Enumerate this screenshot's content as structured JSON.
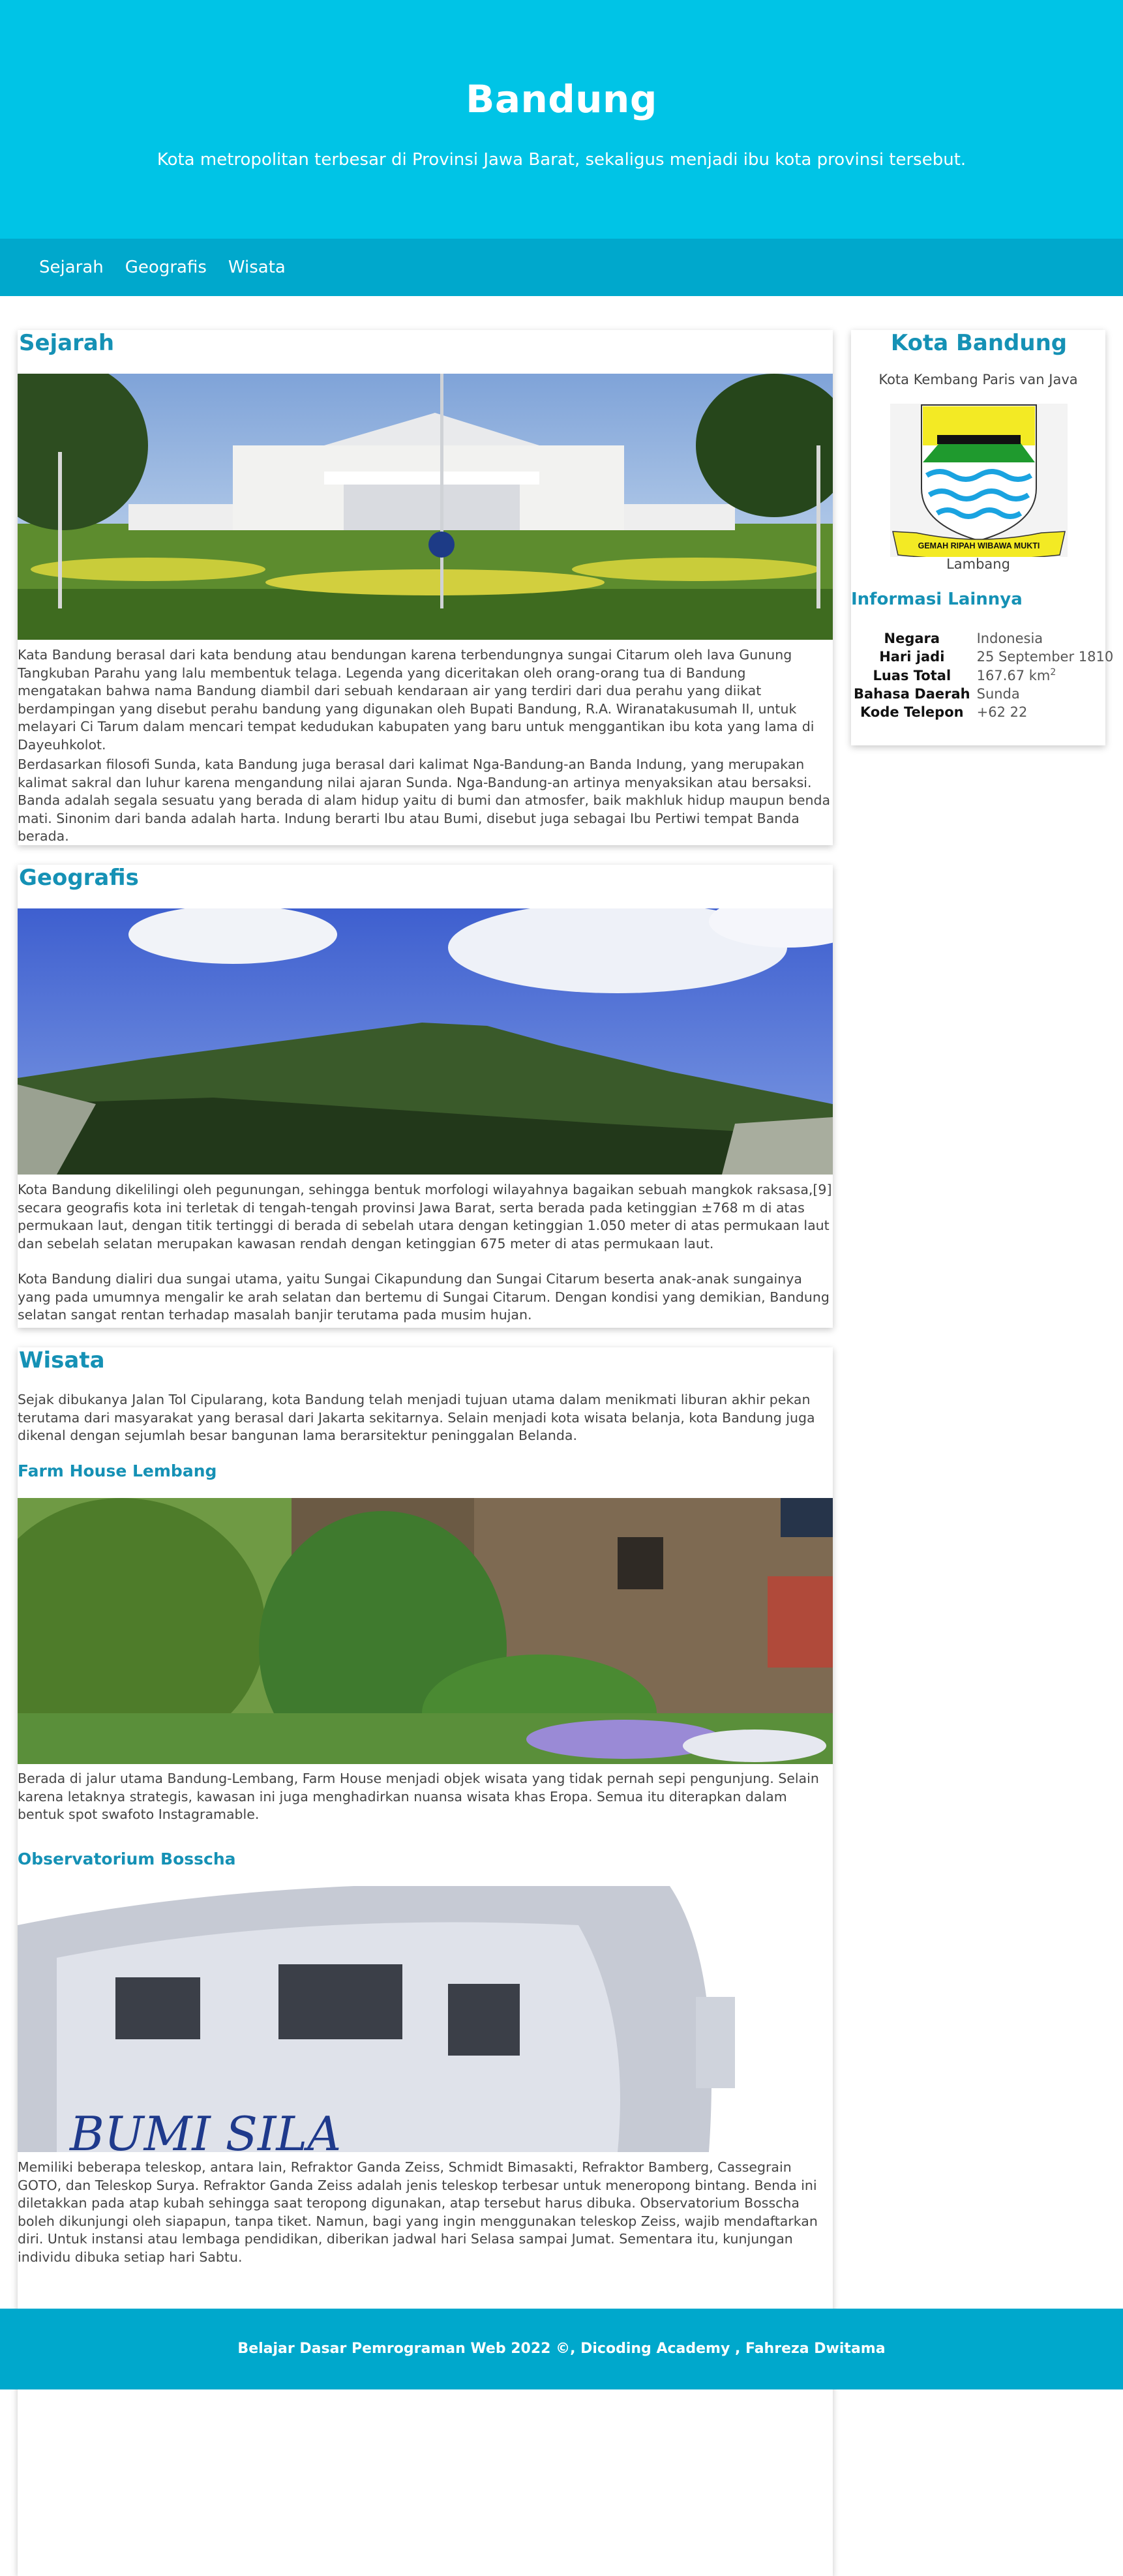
{
  "header": {
    "title": "Bandung",
    "tagline": "Kota metropolitan terbesar di Provinsi Jawa Barat, sekaligus menjadi ibu kota provinsi tersebut."
  },
  "nav": {
    "items": [
      {
        "label": "Sejarah"
      },
      {
        "label": "Geografis"
      },
      {
        "label": "Wisata"
      }
    ]
  },
  "sejarah": {
    "title": "Sejarah",
    "paragraphs": [
      "Kata Bandung berasal dari kata bendung atau bendungan karena terbendungnya sungai Citarum oleh lava Gunung Tangkuban Parahu yang lalu membentuk telaga. Legenda yang diceritakan oleh orang-orang tua di Bandung mengatakan bahwa nama Bandung diambil dari sebuah kendaraan air yang terdiri dari dua perahu yang diikat berdampingan yang disebut perahu bandung yang digunakan oleh Bupati Bandung, R.A. Wiranatakusumah II, untuk melayari Ci Tarum dalam mencari tempat kedudukan kabupaten yang baru untuk menggantikan ibu kota yang lama di Dayeuhkolot.",
      "Berdasarkan filosofi Sunda, kata Bandung juga berasal dari kalimat Nga-Bandung-an Banda Indung, yang merupakan kalimat sakral dan luhur karena mengandung nilai ajaran Sunda. Nga-Bandung-an artinya menyaksikan atau bersaksi. Banda adalah segala sesuatu yang berada di alam hidup yaitu di bumi dan atmosfer, baik makhluk hidup maupun benda mati. Sinonim dari banda adalah harta. Indung berarti Ibu atau Bumi, disebut juga sebagai Ibu Pertiwi tempat Banda berada."
    ]
  },
  "geografis": {
    "title": "Geografis",
    "paragraphs": [
      "Kota Bandung dikelilingi oleh pegunungan, sehingga bentuk morfologi wilayahnya bagaikan sebuah mangkok raksasa,[9] secara geografis kota ini terletak di tengah-tengah provinsi Jawa Barat, serta berada pada ketinggian ±768 m di atas permukaan laut, dengan titik tertinggi di berada di sebelah utara dengan ketinggian 1.050 meter di atas permukaan laut dan sebelah selatan merupakan kawasan rendah dengan ketinggian 675 meter di atas permukaan laut.",
      "Kota Bandung dialiri dua sungai utama, yaitu Sungai Cikapundung dan Sungai Citarum beserta anak-anak sungainya yang pada umumnya mengalir ke arah selatan dan bertemu di Sungai Citarum. Dengan kondisi yang demikian, Bandung selatan sangat rentan terhadap masalah banjir terutama pada musim hujan."
    ]
  },
  "wisata": {
    "title": "Wisata",
    "intro": "Sejak dibukanya Jalan Tol Cipularang, kota Bandung telah menjadi tujuan utama dalam menikmati liburan akhir pekan terutama dari masyarakat yang berasal dari Jakarta sekitarnya. Selain menjadi kota wisata belanja, kota Bandung juga dikenal dengan sejumlah besar bangunan lama berarsitektur peninggalan Belanda.",
    "places": [
      {
        "name": "Farm House Lembang",
        "text": "Berada di jalur utama Bandung-Lembang, Farm House menjadi objek wisata yang tidak pernah sepi pengunjung. Selain karena letaknya strategis, kawasan ini juga menghadirkan nuansa wisata khas Eropa. Semua itu diterapkan dalam bentuk spot swafoto Instagramable."
      },
      {
        "name": "Observatorium Bosscha",
        "text": "Memiliki beberapa teleskop, antara lain, Refraktor Ganda Zeiss, Schmidt Bimasakti, Refraktor Bamberg, Cassegrain GOTO, dan Teleskop Surya. Refraktor Ganda Zeiss adalah jenis teleskop terbesar untuk meneropong bintang. Benda ini diletakkan pada atap kubah sehingga saat teropong digunakan, atap tersebut harus dibuka. Observatorium Bosscha boleh dikunjungi oleh siapapun, tanpa tiket. Namun, bagi yang ingin menggunakan teleskop Zeiss, wajib mendaftarkan diri. Untuk instansi atau lembaga pendidikan, diberikan jadwal hari Selasa sampai Jumat. Sementara itu, kunjungan individu dibuka setiap hari Sabtu.",
        "sign_text": "BUMI SILA"
      }
    ]
  },
  "aside": {
    "title": "Kota Bandung",
    "subtitle": "Kota Kembang Paris van Java",
    "emblem_motto": "GEMAH RIPAH WIBAWA MUKTI",
    "emblem_caption": "Lambang",
    "info_title": "Informasi Lainnya",
    "info": [
      {
        "label": "Negara",
        "value": "Indonesia"
      },
      {
        "label": "Hari jadi",
        "value": "25 September 1810"
      },
      {
        "label": "Luas Total",
        "value": "167.67 km",
        "sup": "2"
      },
      {
        "label": "Bahasa Daerah",
        "value": "Sunda"
      },
      {
        "label": "Kode Telepon",
        "value": "+62 22"
      }
    ]
  },
  "footer": {
    "text": "Belajar Dasar Pemrograman Web 2022 ©, Dicoding Academy , Fahreza Dwitama"
  },
  "colors": {
    "header_bg": "#00c4e6",
    "nav_bg": "#00a8cc",
    "heading": "#1591b5"
  }
}
